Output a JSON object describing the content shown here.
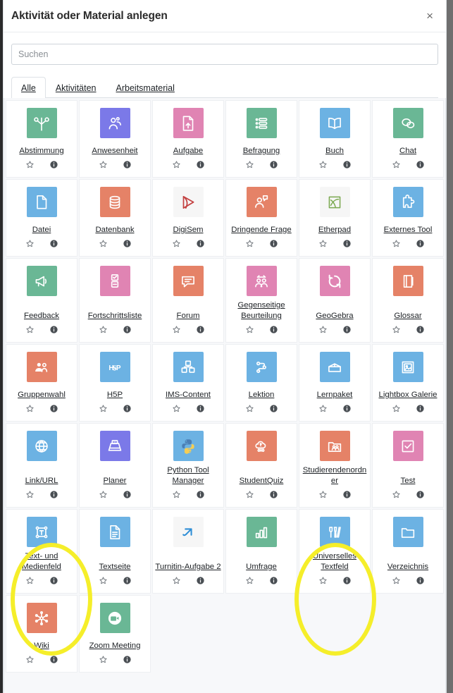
{
  "dialog": {
    "title": "Aktivität oder Material anlegen",
    "close_label": "×"
  },
  "search": {
    "placeholder": "Suchen",
    "value": ""
  },
  "tabs": [
    {
      "label": "Alle",
      "active": true
    },
    {
      "label": "Aktivitäten",
      "active": false
    },
    {
      "label": "Arbeitsmaterial",
      "active": false
    }
  ],
  "colors": {
    "green": "#6ab795",
    "blue": "#6cb2e3",
    "red": "#e58267",
    "pink": "#e084b3",
    "purple": "#7b79e8",
    "light": "#f6f6f6",
    "highlight": "#f5ee2a"
  },
  "card_actions": {
    "star_label": "Favorit",
    "info_label": "Info"
  },
  "items": [
    {
      "label": "Abstimmung",
      "icon": "choice-icon",
      "color": "green"
    },
    {
      "label": "Anwesenheit",
      "icon": "attendance-icon",
      "color": "purple"
    },
    {
      "label": "Aufgabe",
      "icon": "assignment-icon",
      "color": "pink"
    },
    {
      "label": "Befragung",
      "icon": "survey-icon",
      "color": "green"
    },
    {
      "label": "Buch",
      "icon": "book-icon",
      "color": "blue"
    },
    {
      "label": "Chat",
      "icon": "chat-icon",
      "color": "green"
    },
    {
      "label": "Datei",
      "icon": "file-icon",
      "color": "blue"
    },
    {
      "label": "Datenbank",
      "icon": "database-icon",
      "color": "red"
    },
    {
      "label": "DigiSem",
      "icon": "digisem-icon",
      "color": "light"
    },
    {
      "label": "Dringende Frage",
      "icon": "urgent-question-icon",
      "color": "red"
    },
    {
      "label": "Etherpad",
      "icon": "etherpad-icon",
      "color": "light"
    },
    {
      "label": "Externes Tool",
      "icon": "puzzle-icon",
      "color": "blue"
    },
    {
      "label": "Feedback",
      "icon": "megaphone-icon",
      "color": "green"
    },
    {
      "label": "Fortschrittsliste",
      "icon": "checklist-icon",
      "color": "pink"
    },
    {
      "label": "Forum",
      "icon": "forum-icon",
      "color": "red"
    },
    {
      "label": "Gegenseitige Beurteilung",
      "icon": "workshop-icon",
      "color": "pink"
    },
    {
      "label": "GeoGebra",
      "icon": "geogebra-icon",
      "color": "pink"
    },
    {
      "label": "Glossar",
      "icon": "glossary-icon",
      "color": "red"
    },
    {
      "label": "Gruppenwahl",
      "icon": "group-choice-icon",
      "color": "red"
    },
    {
      "label": "H5P",
      "icon": "h5p-icon",
      "color": "blue"
    },
    {
      "label": "IMS-Content",
      "icon": "ims-content-icon",
      "color": "blue"
    },
    {
      "label": "Lektion",
      "icon": "lesson-icon",
      "color": "blue"
    },
    {
      "label": "Lernpaket",
      "icon": "scorm-icon",
      "color": "blue"
    },
    {
      "label": "Lightbox Galerie",
      "icon": "gallery-icon",
      "color": "blue"
    },
    {
      "label": "Link/URL",
      "icon": "globe-icon",
      "color": "blue"
    },
    {
      "label": "Planer",
      "icon": "scheduler-icon",
      "color": "purple"
    },
    {
      "label": "Python Tool Manager",
      "icon": "python-icon",
      "color": "blue"
    },
    {
      "label": "StudentQuiz",
      "icon": "studentquiz-icon",
      "color": "red"
    },
    {
      "label": "Studierendenordner",
      "icon": "student-folder-icon",
      "color": "red"
    },
    {
      "label": "Test",
      "icon": "quiz-icon",
      "color": "pink"
    },
    {
      "label": "Text- und Medienfeld",
      "icon": "text-media-icon",
      "color": "blue",
      "highlighted": true
    },
    {
      "label": "Textseite",
      "icon": "page-icon",
      "color": "blue"
    },
    {
      "label": "Turnitin-Aufgabe 2",
      "icon": "turnitin-icon",
      "color": "light"
    },
    {
      "label": "Umfrage",
      "icon": "feedback-icon",
      "color": "green"
    },
    {
      "label": "Universelles Textfeld",
      "icon": "universal-text-icon",
      "color": "blue",
      "highlighted": true
    },
    {
      "label": "Verzeichnis",
      "icon": "folder-icon",
      "color": "blue"
    },
    {
      "label": "Wiki",
      "icon": "wiki-icon",
      "color": "red"
    },
    {
      "label": "Zoom Meeting",
      "icon": "zoom-icon",
      "color": "green"
    }
  ]
}
